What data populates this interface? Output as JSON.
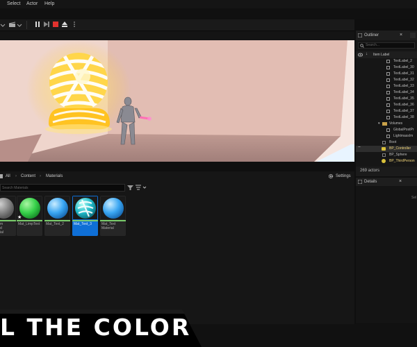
{
  "menu": {
    "items": [
      "Select",
      "Actor",
      "Help"
    ]
  },
  "outliner": {
    "title": "Outliner",
    "search_placeholder": "Search...",
    "column_label": "Item Label",
    "rows": [
      "TextLabel_2",
      "TextLabel_30",
      "TextLabel_31",
      "TextLabel_32",
      "TextLabel_33",
      "TextLabel_34",
      "TextLabel_35",
      "TextLabel_36",
      "TextLabel_37",
      "TextLabel_38",
      "Volumes",
      "GlobalPostPr",
      "LightmassIm",
      "Boot",
      "BP_Controller",
      "BP_Sphere",
      "BP_ThirdPerson"
    ],
    "actor_count": "269 actors"
  },
  "details": {
    "title": "Details",
    "hint": "Sel"
  },
  "content_browser": {
    "breadcrumb": [
      "All",
      "Content",
      "Materials"
    ],
    "settings_label": "Settings",
    "search_placeholder": "Search Materials",
    "assets": [
      {
        "name": "m\nd\nial",
        "color": "#8a8a8a",
        "selected": false
      },
      {
        "name": "Mat_LimpText",
        "color": "#37d14a",
        "selected": false
      },
      {
        "name": "Mat_Text_2",
        "color": "#3aa6f2",
        "selected": false
      },
      {
        "name": "Mat_Text_3",
        "color": "#1fb9c9",
        "selected": true
      },
      {
        "name": "Mat_Text\nMaterial",
        "color": "#3aa6f2",
        "selected": false
      }
    ]
  },
  "banner": {
    "text": "L THE COLOR"
  },
  "colors": {
    "accent_blue": "#0f6fd6",
    "material_bar_green": "#7acc6b",
    "play_red": "#e0322e",
    "sphere_yellow": "#ffc21a"
  }
}
